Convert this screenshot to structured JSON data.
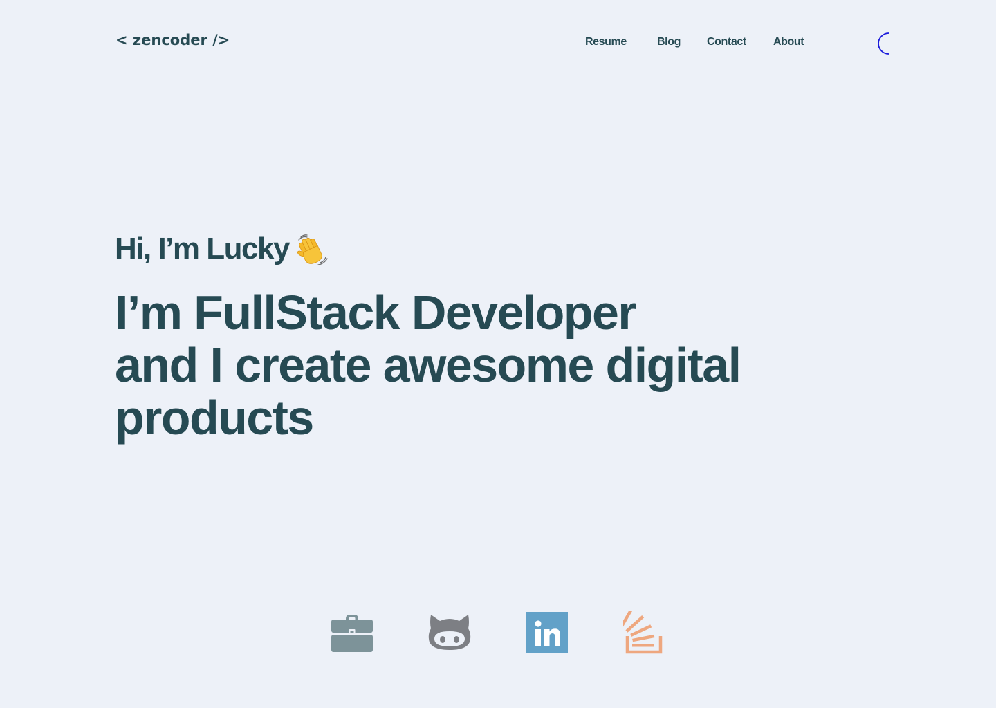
{
  "header": {
    "logo": "< zencoder />",
    "nav": [
      {
        "label": "Resume"
      },
      {
        "label": "Blog"
      },
      {
        "label": "Contact"
      },
      {
        "label": "About"
      }
    ],
    "theme_toggle_icon": "moon-icon"
  },
  "hero": {
    "greeting": "Hi, I’m Lucky",
    "greeting_emoji_icon": "waving-hand-icon",
    "headline_lines": [
      "I’m FullStack Developer",
      "and I create awesome digital",
      "products"
    ]
  },
  "socials": [
    {
      "icon": "briefcase-icon",
      "color": "#7d9399"
    },
    {
      "icon": "github-icon",
      "color": "#7d7f84"
    },
    {
      "icon": "linkedin-icon",
      "color": "#62a1c8"
    },
    {
      "icon": "stackoverflow-icon",
      "color": "#eea77f"
    }
  ],
  "colors": {
    "background": "#edf1f8",
    "text": "#264a53",
    "toggle": "#1a1adb"
  }
}
